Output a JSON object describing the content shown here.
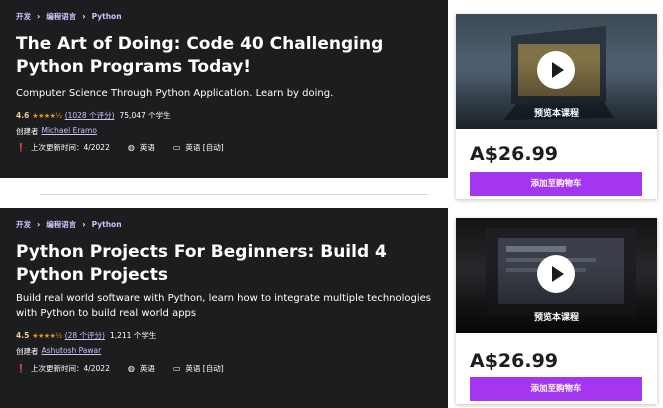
{
  "courses": [
    {
      "breadcrumb": [
        "开发",
        "编程语言",
        "Python"
      ],
      "title": "The Art of Doing: Code 40 Challenging Python Programs Today!",
      "subtitle": "Computer Science Through Python Application. Learn by doing.",
      "rating": "4.6",
      "stars": "★★★★½",
      "rating_count": "(1028 个评分)",
      "students": "75,047 个学生",
      "created_by_label": "创建者",
      "creator": "Michael Eramo",
      "last_updated": "上次更新时间：4/2022",
      "language": "英语",
      "captions": "英语 [自动]",
      "preview_label": "预览本课程",
      "price": "A$26.99",
      "cart_button": "添加至购物车"
    },
    {
      "breadcrumb": [
        "开发",
        "编程语言",
        "Python"
      ],
      "title": "Python Projects For Beginners: Build 4 Python Projects",
      "subtitle": "Build real world software with Python, learn how to integrate multiple technologies with Python to build real world apps",
      "rating": "4.5",
      "stars": "★★★★½",
      "rating_count": "(28 个评分)",
      "students": "1,211 个学生",
      "created_by_label": "创建者",
      "creator": "Ashutosh Pawar",
      "last_updated": "上次更新时间：4/2022",
      "language": "英语",
      "captions": "英语 [自动]",
      "preview_label": "预览本课程",
      "price": "A$26.99",
      "cart_button": "添加至购物车"
    }
  ],
  "colors": {
    "hero_bg": "#1c1d1f",
    "link_purple": "#cec0fc",
    "rating_orange": "#f3ca8c",
    "star_color": "#e59819",
    "cta_purple": "#a435f0"
  },
  "icons": {
    "breadcrumb_separator": "chevron-right-icon",
    "update": "alert-icon",
    "language": "globe-icon",
    "captions": "closed-captions-icon",
    "preview": "play-icon"
  }
}
